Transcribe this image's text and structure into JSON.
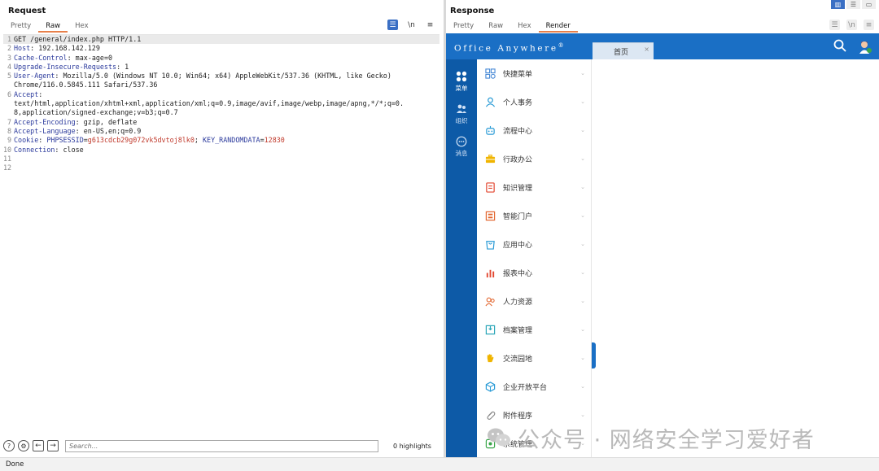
{
  "request": {
    "title": "Request",
    "tabs": [
      "Pretty",
      "Raw",
      "Hex"
    ],
    "active_tab": "Raw",
    "tool_wrap": "☰",
    "tool_newline": "\\n",
    "tool_menu": "≡",
    "lines": [
      {
        "n": "1",
        "text": "GET /general/index.php HTTP/1.1"
      },
      {
        "n": "2",
        "key": "Host",
        "value": " 192.168.142.129"
      },
      {
        "n": "3",
        "key": "Cache-Control",
        "value": " max-age=0"
      },
      {
        "n": "4",
        "key": "Upgrade-Insecure-Requests",
        "value": " 1"
      },
      {
        "n": "5",
        "key": "User-Agent",
        "value": " Mozilla/5.0 (Windows NT 10.0; Win64; x64) AppleWebKit/537.36 (KHTML, like Gecko)"
      },
      {
        "n": "",
        "text": "Chrome/116.0.5845.111 Safari/537.36"
      },
      {
        "n": "6",
        "key": "Accept",
        "value": ""
      },
      {
        "n": "",
        "text": "text/html,application/xhtml+xml,application/xml;q=0.9,image/avif,image/webp,image/apng,*/*;q=0."
      },
      {
        "n": "",
        "text": "8,application/signed-exchange;v=b3;q=0.7"
      },
      {
        "n": "7",
        "key": "Accept-Encoding",
        "value": " gzip, deflate"
      },
      {
        "n": "8",
        "key": "Accept-Language",
        "value": " en-US,en;q=0.9"
      },
      {
        "n": "9",
        "cookie": true,
        "key": "Cookie",
        "c1k": "PHPSESSID",
        "c1v": "g613cdcb29g072vk5dvtoj8lk0",
        "c2k": "KEY_RANDOMDATA",
        "c2v": "12830"
      },
      {
        "n": "10",
        "key": "Connection",
        "value": " close"
      },
      {
        "n": "11",
        "text": ""
      },
      {
        "n": "12",
        "text": ""
      }
    ],
    "search_placeholder": "Search...",
    "highlights": "0 highlights"
  },
  "response": {
    "title": "Response",
    "tabs": [
      "Pretty",
      "Raw",
      "Hex",
      "Render"
    ],
    "active_tab": "Render",
    "oa": {
      "logo": "Office Anywhere",
      "logo_mark": "®",
      "tab_label": "首页",
      "tab_close": "×",
      "rail": [
        {
          "label": "菜单",
          "icon": "grid-icon"
        },
        {
          "label": "组织",
          "icon": "people-icon"
        },
        {
          "label": "消息",
          "icon": "chat-icon"
        }
      ],
      "menu": [
        {
          "label": "快捷菜单",
          "icon": "shortcut-icon",
          "color": "#4a8ad6"
        },
        {
          "label": "个人事务",
          "icon": "person-icon",
          "color": "#2a9bd6"
        },
        {
          "label": "流程中心",
          "icon": "robot-icon",
          "color": "#2a9bd6"
        },
        {
          "label": "行政办公",
          "icon": "briefcase-icon",
          "color": "#f0b400"
        },
        {
          "label": "知识管理",
          "icon": "book-icon",
          "color": "#e2462f"
        },
        {
          "label": "智能门户",
          "icon": "portal-icon",
          "color": "#e2662f"
        },
        {
          "label": "应用中心",
          "icon": "app-icon",
          "color": "#2a9bd6"
        },
        {
          "label": "报表中心",
          "icon": "report-icon",
          "color": "#e2462f"
        },
        {
          "label": "人力资源",
          "icon": "hr-icon",
          "color": "#e2662f"
        },
        {
          "label": "档案管理",
          "icon": "archive-icon",
          "color": "#2aa6b8"
        },
        {
          "label": "交流园地",
          "icon": "hand-icon",
          "color": "#f0b400"
        },
        {
          "label": "企业开放平台",
          "icon": "cube-icon",
          "color": "#2a9bd6"
        },
        {
          "label": "附件程序",
          "icon": "paperclip-icon",
          "color": "#888888"
        },
        {
          "label": "系统管理",
          "icon": "gear-icon",
          "color": "#3aa64a"
        }
      ]
    }
  },
  "watermark": "公众号 · 网络安全学习爱好者",
  "status": "Done",
  "colors": {
    "accent": "#e8804a",
    "oa_blue": "#1a6fc5",
    "oa_rail": "#0d5aa7",
    "header_key": "#2b3a9c",
    "cookie_value": "#c0392b"
  }
}
